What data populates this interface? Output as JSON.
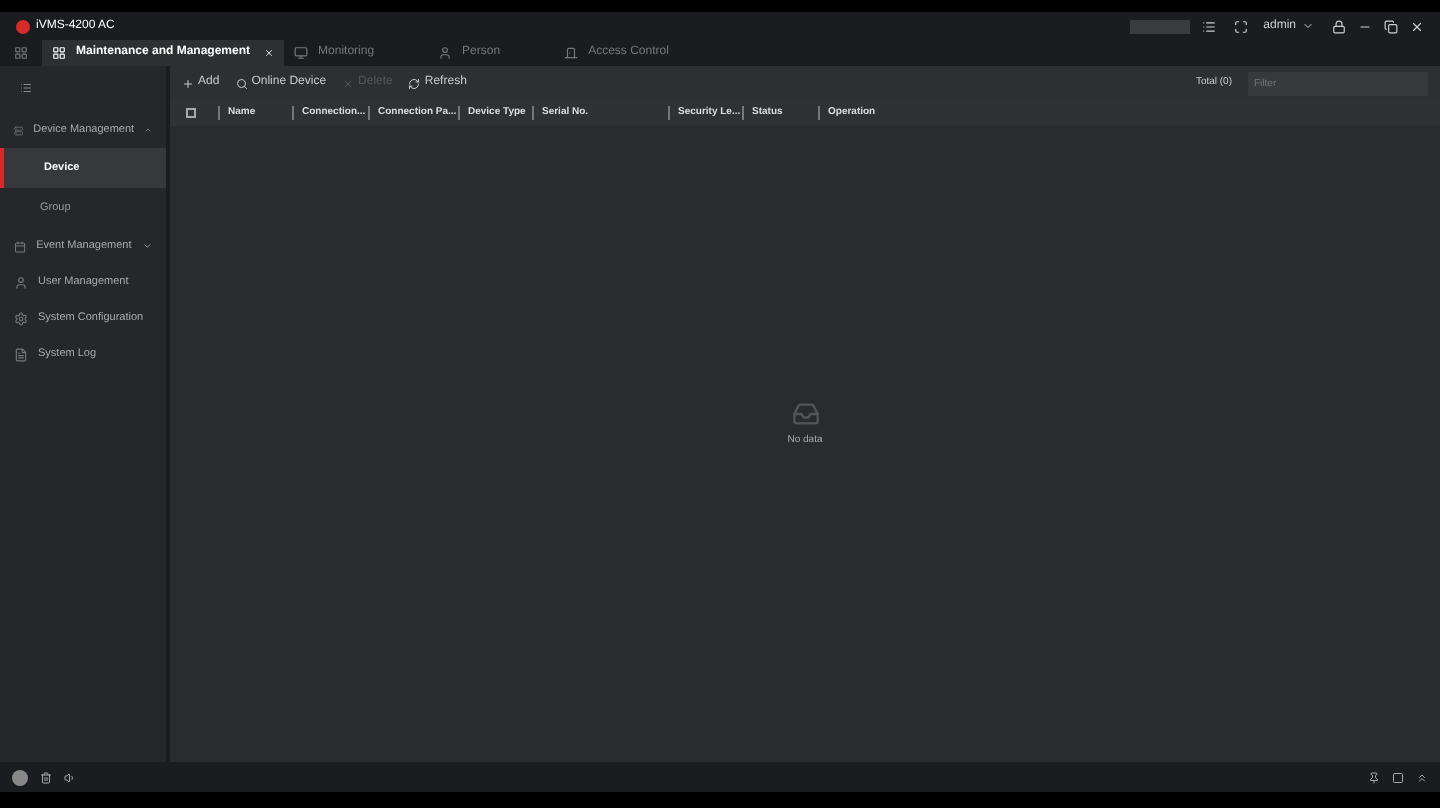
{
  "app": {
    "title": "iVMS-4200 AC"
  },
  "tabs": [
    {
      "label": "Maintenance and Management",
      "selected": true
    },
    {
      "label": "Monitoring",
      "selected": false
    },
    {
      "label": "Person",
      "selected": false
    },
    {
      "label": "Access Control",
      "selected": false
    }
  ],
  "user": {
    "name": "admin"
  },
  "sidebar": {
    "items": [
      {
        "label": "Device Management",
        "expanded": true,
        "children": [
          {
            "label": "Device",
            "selected": true
          },
          {
            "label": "Group",
            "selected": false
          }
        ]
      },
      {
        "label": "Event Management",
        "expanded": false
      },
      {
        "label": "User Management"
      },
      {
        "label": "System Configuration"
      },
      {
        "label": "System Log"
      }
    ]
  },
  "toolbar": {
    "buttons": [
      {
        "label": "Add",
        "disabled": false
      },
      {
        "label": "Online Device",
        "disabled": false
      },
      {
        "label": "Delete",
        "disabled": true
      },
      {
        "label": "Refresh",
        "disabled": false
      }
    ],
    "total": "Total (0)",
    "filter": {
      "placeholder": "Filter"
    }
  },
  "table": {
    "select_all": {
      "checked": false
    },
    "columns": [
      "Name",
      "Connection...",
      "Connection Pa...",
      "Device Type",
      "Serial No.",
      "Security Le...",
      "Status",
      "Operation"
    ],
    "empty_text": "No data"
  }
}
